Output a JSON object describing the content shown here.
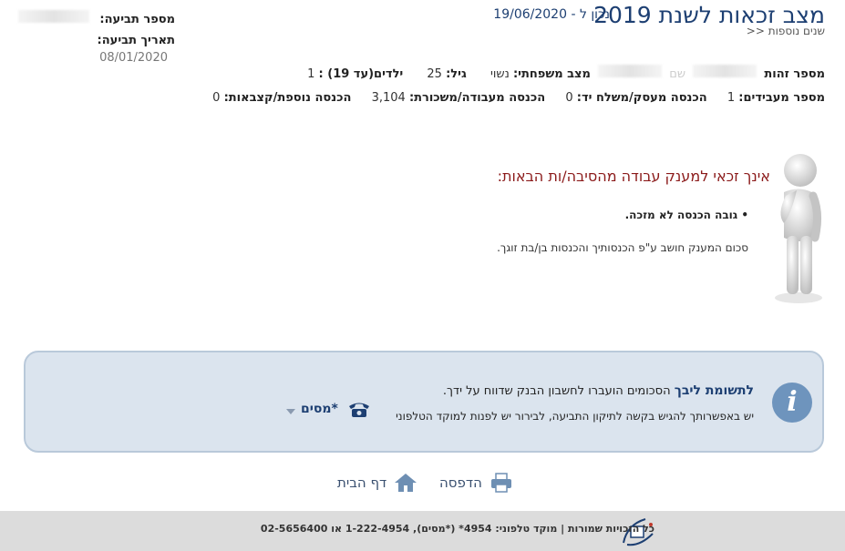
{
  "header": {
    "title": "מצב זכאות לשנת 2019",
    "as_of": "נכון ל - 19/06/2020",
    "more_years": "שנים נוספות <<"
  },
  "claim": {
    "number_label": "מספר תביעה:",
    "date_label": "תאריך תביעה:",
    "date_value": "08/01/2020"
  },
  "personal": {
    "id_label": "מספר זהות",
    "name_label": "שם",
    "marital_label": "מצב משפחתי:",
    "marital_value": "נשוי",
    "age_label": "גיל:",
    "age_value": "25",
    "children_label": "ילדים(עד 19) :",
    "children_value": "1",
    "employers_label": "מספר מעבידים:",
    "employers_value": "1",
    "business_income_label": "הכנסה מעסק/משלח יד:",
    "business_income_value": "0",
    "work_income_label": "הכנסה מעבודה/משכורת:",
    "work_income_value": "3,104",
    "additional_income_label": "הכנסה נוספת/קצבאות:",
    "additional_income_value": "0"
  },
  "result": {
    "headline": "אינך זכאי למענק עבודה מהסיבה/ות הבאות:",
    "reason": "• גובה הכנסה לא מזכה.",
    "note": "סכום המענק חושב ע\"פ הכנסותיך והכנסות בן/בת זוגך."
  },
  "infobox": {
    "attention": "לתשומת ליבך",
    "line1": "הסכומים הועברו לחשבון הבנק שדווח על ידך.",
    "line2": "יש באפשרותך להגיש בקשה לתיקון התביעה, לבירור יש לפנות למוקד הטלפוני",
    "tax_label": "*מסים",
    "icon": "info-icon"
  },
  "actions": {
    "print": "הדפסה",
    "home": "דף הבית"
  },
  "footer": {
    "text": "כל הזכויות שמורות   |   מוקד טלפוני: 4954* (*מסים), 1-222-4954  או  02-5656400"
  },
  "colors": {
    "title": "#1d3f72",
    "headline": "#8b1a1a",
    "infobox_bg": "#dbe4ee",
    "footer_bg": "#dcdcdc"
  }
}
